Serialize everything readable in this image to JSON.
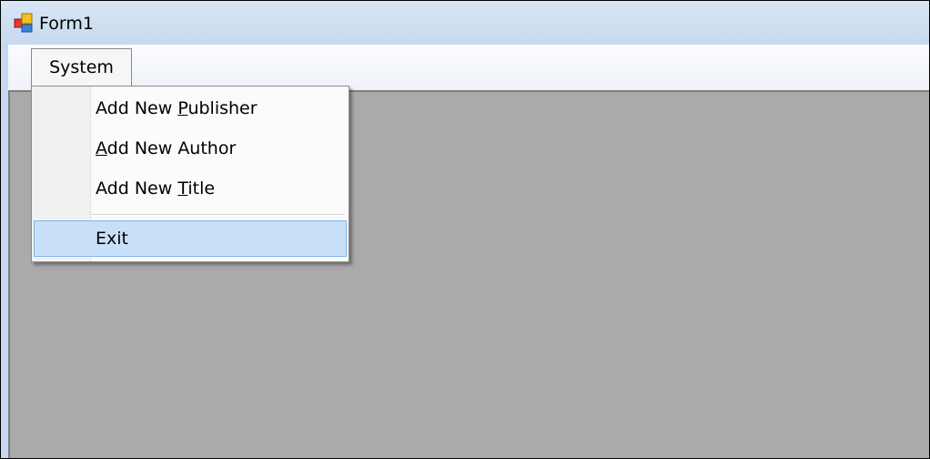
{
  "window": {
    "title": "Form1"
  },
  "menubar": {
    "menus": [
      {
        "label": "System"
      }
    ]
  },
  "dropdown": {
    "items": [
      {
        "label": "Add New Publisher",
        "access_key": "P"
      },
      {
        "label": "Add New Author",
        "access_key": "A"
      },
      {
        "label": "Add New Title",
        "access_key": "T"
      },
      {
        "label": "Exit",
        "highlighted": true
      }
    ]
  },
  "icons": {
    "app": "form-window-icon"
  },
  "colors": {
    "titlebar": "#c6d9ef",
    "client_background": "#aba9aa",
    "highlight_fill": "#c7e0f8",
    "highlight_border": "#7fb3e6"
  }
}
